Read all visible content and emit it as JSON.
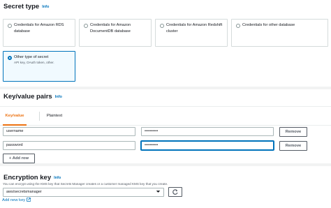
{
  "secret_type": {
    "title": "Secret type",
    "info": "Info",
    "options": [
      {
        "title": "Credentials for Amazon RDS database",
        "desc": "",
        "selected": false
      },
      {
        "title": "Credentials for Amazon DocumentDB database",
        "desc": "",
        "selected": false
      },
      {
        "title": "Credentials for Amazon Redshift cluster",
        "desc": "",
        "selected": false
      },
      {
        "title": "Credentials for other database",
        "desc": "",
        "selected": false
      },
      {
        "title": "Other type of secret",
        "desc": "API key, OAuth token, other.",
        "selected": true
      }
    ]
  },
  "kv": {
    "title": "Key/value pairs",
    "info": "Info",
    "tabs": [
      {
        "label": "Key/value",
        "active": true
      },
      {
        "label": "Plaintext",
        "active": false
      }
    ],
    "rows": [
      {
        "key": "username",
        "value": "••••••••••",
        "remove_label": "Remove"
      },
      {
        "key": "password",
        "value": "••••••••••",
        "remove_label": "Remove"
      }
    ],
    "add_row_label": "+ Add row"
  },
  "encryption": {
    "title": "Encryption key",
    "info": "Info",
    "description": "You can encrypt using the KMS key that Secrets Manager creates or a customer managed KMS key that you create.",
    "selected_key": "aws/secretsmanager",
    "add_new_key_label": "Add new key",
    "icons": {
      "dropdown": "chevron-down-icon",
      "refresh": "refresh-icon",
      "external": "external-link-icon"
    }
  },
  "colors": {
    "accent": "#ec7211",
    "link": "#0073bb",
    "border": "#aab7b8"
  }
}
